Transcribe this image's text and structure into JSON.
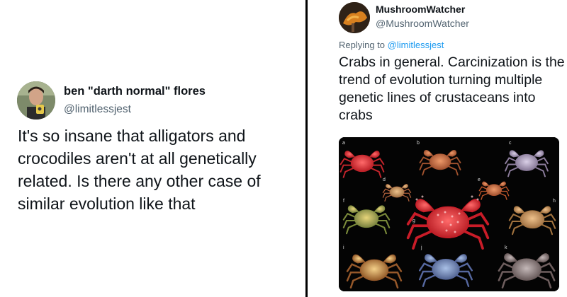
{
  "left_tweet": {
    "display_name": "ben \"darth normal\" flores",
    "handle": "@limitlessjest",
    "text": "It's so insane that alligators and crocodiles aren't at all genetically related. Is there any other case of similar evolution like that"
  },
  "right_tweet": {
    "display_name": "MushroomWatcher",
    "handle": "@MushroomWatcher",
    "replying_prefix": "Replying to ",
    "replying_handle": "@limitlessjest",
    "text": "Crabs in general.  Carcinization is the trend of evolution turning multiple genetic lines of crustaceans into crabs",
    "media": {
      "panel_labels": [
        "a",
        "b",
        "c",
        "d",
        "e",
        "f",
        "g",
        "h",
        "i",
        "j",
        "k"
      ]
    }
  },
  "colors": {
    "handle_gray": "#536471",
    "link_blue": "#1d9bf0",
    "divider": "#000000"
  }
}
